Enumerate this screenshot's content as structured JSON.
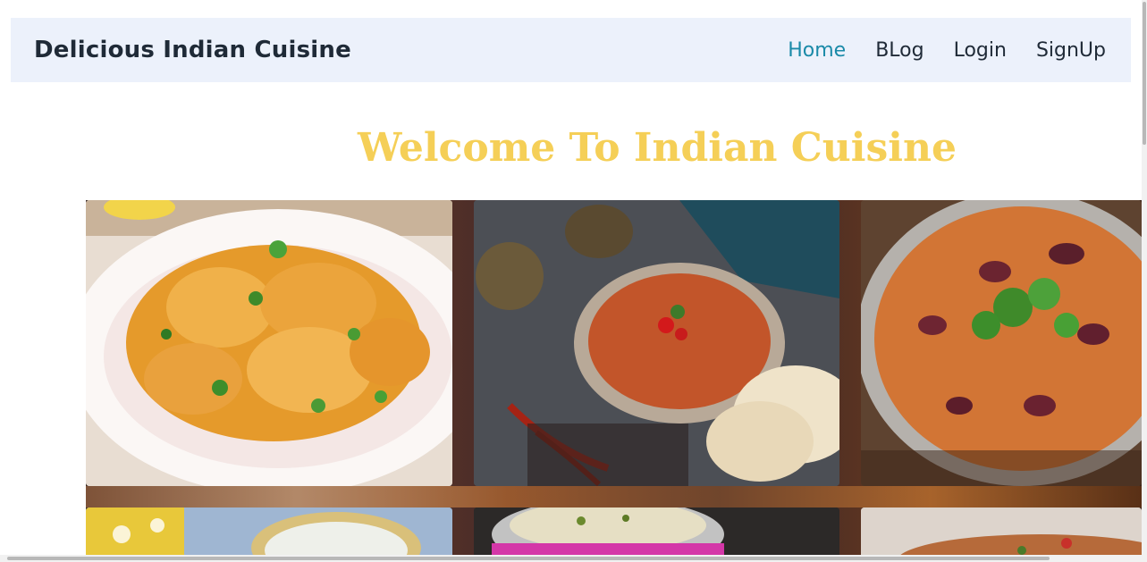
{
  "header": {
    "brand": "Delicious Indian Cuisine",
    "nav": [
      {
        "label": "Home",
        "active": true
      },
      {
        "label": "BLog",
        "active": false
      },
      {
        "label": "Login",
        "active": false
      },
      {
        "label": "SignUp",
        "active": false
      }
    ]
  },
  "main": {
    "title": "Welcome To Indian Cuisine"
  },
  "gallery": [
    {
      "icon": "chicken-curry-image"
    },
    {
      "icon": "dal-with-naan-image"
    },
    {
      "icon": "rajma-curry-image"
    },
    {
      "icon": "raita-bowl-image"
    },
    {
      "icon": "biryani-pot-image"
    },
    {
      "icon": "curry-dish-image"
    }
  ],
  "colors": {
    "nav_bg": "#ecf1fb",
    "active_link": "#1a8aa8",
    "title": "#f5cf57"
  }
}
